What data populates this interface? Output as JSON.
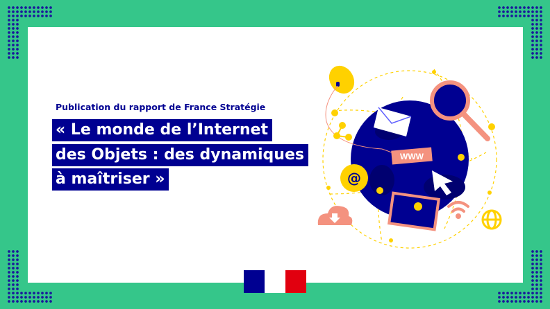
{
  "header": {
    "subtitle": "Publication du rapport de France Stratégie"
  },
  "title": {
    "lines": [
      "« Le monde de l’Internet",
      "des Objets : des dynamiques",
      "à maîtriser »"
    ]
  },
  "illustration": {
    "www_label": "WWW",
    "icons": [
      "mouse-icon",
      "envelope-icon",
      "magnifier-icon",
      "at-icon",
      "cursor-icon",
      "image-icon",
      "wifi-icon",
      "globe-icon",
      "cloud-download-icon",
      "share-icon"
    ]
  },
  "logo": {
    "name": "Marianne République Française logo"
  },
  "colors": {
    "background": "#35c68a",
    "navy": "#000091",
    "salmon": "#f4927f",
    "yellow": "#ffd100",
    "red": "#e1000f"
  }
}
